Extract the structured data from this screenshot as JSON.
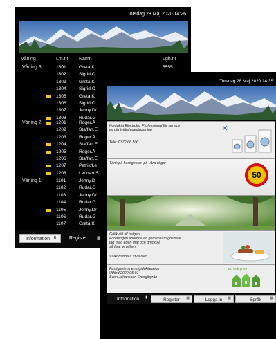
{
  "back_screen": {
    "datetime": "Torsdag 28 Maj 2020  14:26",
    "columns": {
      "floor": "Våning",
      "lm": "Lm.nr",
      "name": "Namn",
      "lgh": "Lgh.nr"
    },
    "floors": [
      {
        "label": "Våning 3",
        "rows": [
          {
            "no": "1301",
            "name": "Greta.K",
            "flag": false,
            "phone": "5555"
          },
          {
            "no": "1302",
            "name": "Sigrid.Ö",
            "flag": false,
            "phone": ""
          },
          {
            "no": "1303",
            "name": "Greta.K",
            "flag": false,
            "phone": ""
          },
          {
            "no": "1304",
            "name": "Sigrid.Ö",
            "flag": false,
            "phone": ""
          },
          {
            "no": "1305",
            "name": "Greta.K",
            "flag": true,
            "phone": ""
          },
          {
            "no": "1306",
            "name": "Sigrid.Ö",
            "flag": false,
            "phone": ""
          },
          {
            "no": "1307",
            "name": "Jenny.D/",
            "flag": false,
            "phone": ""
          },
          {
            "no": "1308",
            "name": "Rudar.G",
            "flag": true,
            "phone": ""
          }
        ]
      },
      {
        "label": "Våning 2",
        "rows": [
          {
            "no": "1201",
            "name": "Roger.Å",
            "flag": true,
            "phone": ""
          },
          {
            "no": "1202",
            "name": "Staffan.E",
            "flag": false,
            "phone": ""
          },
          {
            "no": "1203",
            "name": "Roger.Å",
            "flag": false,
            "phone": ""
          },
          {
            "no": "1204",
            "name": "Staffan.E",
            "flag": true,
            "phone": ""
          },
          {
            "no": "1205",
            "name": "Roger.Å",
            "flag": true,
            "phone": ""
          },
          {
            "no": "1206",
            "name": "Staffan.E",
            "flag": false,
            "phone": ""
          },
          {
            "no": "1207",
            "name": "Patrik/Le",
            "flag": true,
            "phone": ""
          },
          {
            "no": "1208",
            "name": "Lennart.S",
            "flag": true,
            "phone": ""
          }
        ]
      },
      {
        "label": "Våning 1",
        "rows": [
          {
            "no": "1101",
            "name": "Jenny.D",
            "flag": false,
            "phone": ""
          },
          {
            "no": "1102",
            "name": "Rudar.G",
            "flag": false,
            "phone": ""
          },
          {
            "no": "1103",
            "name": "Jenny.D/",
            "flag": false,
            "phone": ""
          },
          {
            "no": "1104",
            "name": "Rudar.G",
            "flag": false,
            "phone": ""
          },
          {
            "no": "1105",
            "name": "Jenny.D/",
            "flag": true,
            "phone": ""
          },
          {
            "no": "1106",
            "name": "Rudar.G",
            "flag": false,
            "phone": ""
          },
          {
            "no": "1107",
            "name": "Greta.K",
            "flag": false,
            "phone": ""
          }
        ]
      }
    ],
    "buttons": {
      "information": "Information",
      "register": "Register"
    }
  },
  "front_screen": {
    "datetime": "Torsdag 28 Maj 2020  14:35",
    "cards": {
      "electrolux": {
        "lines": [
          "Kontakta Electrolux Professional för service",
          "av din tvättstugeutrustning",
          "",
          "Tele: 0372 66 500"
        ]
      },
      "speed": {
        "lines": [
          "Tänk på hastigheten på våra vägar"
        ],
        "sign_value": "50"
      },
      "grill": {
        "lines": [
          "Grillkväll till helgen",
          "Föreningen anordna en gemensam grillkväll,",
          "tag med egen mat och dryck så",
          "så fixar vi grillen",
          "",
          "Välkommna  // styrelsen"
        ]
      },
      "energy": {
        "lines": [
          "Fastighetens energideklaration",
          "Utförd 2020 05 01",
          "Sven Johansson Energibyrån"
        ],
        "logo_text": "Bo i vår grönt"
      }
    },
    "buttons": {
      "information": "Information",
      "register": "Register",
      "login": "Logga in",
      "language": "Språk"
    }
  },
  "colors": {
    "screen_bg": "#000000",
    "flag": "#f2c31a",
    "card_bg": "#eeeeee"
  }
}
